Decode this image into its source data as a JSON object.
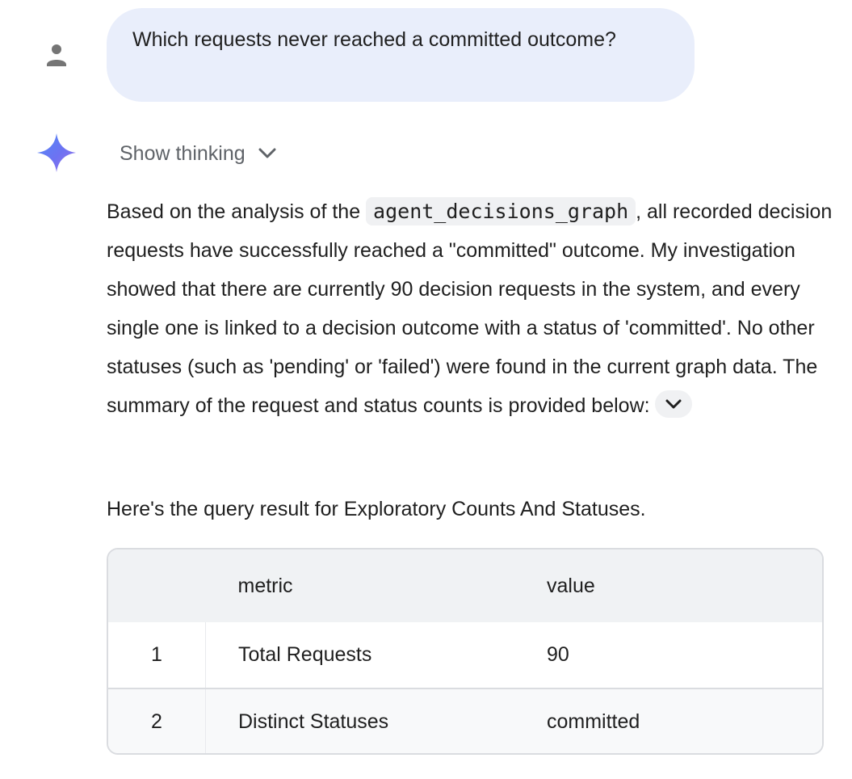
{
  "user_turn": {
    "avatar_icon": "person-icon",
    "message": "Which requests never reached a committed outcome?"
  },
  "model_turn": {
    "logo_icon": "sparkle-icon",
    "show_thinking_label": "Show thinking",
    "answer": {
      "text_before_code": "Based on the analysis of the ",
      "code": "agent_decisions_graph",
      "text_after_code": ", all recorded decision requests have successfully reached a \"committed\" outcome. My investigation showed that there are currently 90 decision requests in the system, and every single one is linked to a decision outcome with a status of 'committed'. No other statuses (such as 'pending' or 'failed') were found in the current graph data. The summary of the request and status counts is provided below:"
    },
    "result_intro": "Here's the query result for Exploratory Counts And Statuses.",
    "table": {
      "columns": [
        "",
        "metric",
        "value"
      ],
      "rows": [
        {
          "index": "1",
          "metric": "Total Requests",
          "value": "90"
        },
        {
          "index": "2",
          "metric": "Distinct Statuses",
          "value": "committed"
        }
      ]
    }
  },
  "colors": {
    "user_bubble": "#e9eefb",
    "table_header": "#f0f2f4",
    "code_bg": "#f0f1f3",
    "muted_text": "#5f6368"
  }
}
